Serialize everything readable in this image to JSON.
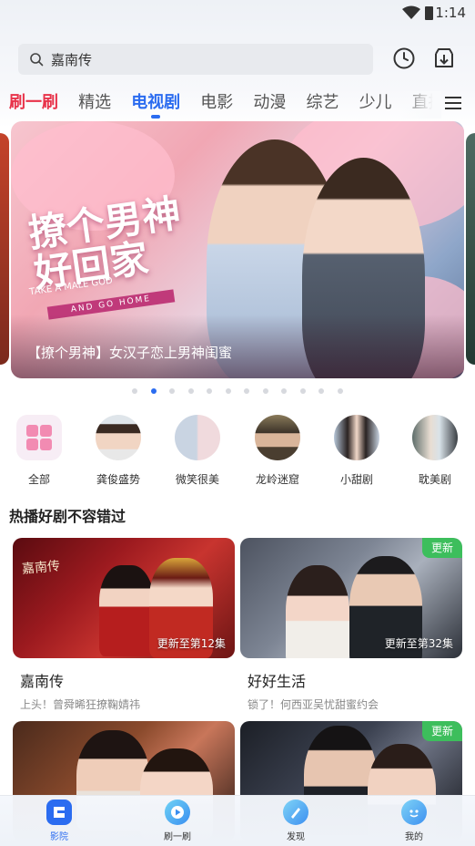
{
  "status_bar": {
    "time": "1:14"
  },
  "search": {
    "query": "嘉南传"
  },
  "tabs": [
    {
      "label": "刷一刷",
      "state": "highlight"
    },
    {
      "label": "精选",
      "state": "normal"
    },
    {
      "label": "电视剧",
      "state": "active"
    },
    {
      "label": "电影",
      "state": "normal"
    },
    {
      "label": "动漫",
      "state": "normal"
    },
    {
      "label": "综艺",
      "state": "normal"
    },
    {
      "label": "少儿",
      "state": "normal"
    },
    {
      "label": "直播",
      "state": "normal"
    }
  ],
  "banner": {
    "caption": "【撩个男神】女汉子恋上男神闺蜜",
    "logo_title": "撩个男神好回家",
    "logo_sub": "TAKE A MALE GOD",
    "logo_band": "AND GO HOME",
    "page_count": 12,
    "active_index": 1
  },
  "categories": [
    {
      "label": "全部",
      "icon": "grid-icon"
    },
    {
      "label": "龚俊盛势",
      "icon": "avatar"
    },
    {
      "label": "微笑很美",
      "icon": "avatar"
    },
    {
      "label": "龙岭迷窟",
      "icon": "avatar"
    },
    {
      "label": "小甜剧",
      "icon": "avatar"
    },
    {
      "label": "耽美剧",
      "icon": "avatar"
    }
  ],
  "section": {
    "title": "热播好剧不容错过"
  },
  "cards": [
    {
      "title": "嘉南传",
      "subtitle": "上头！曾舜晞狂撩鞠婧祎",
      "update": "更新至第12集",
      "badge": "",
      "thumb_text": "嘉南传"
    },
    {
      "title": "好好生活",
      "subtitle": "锁了！何西亚吴忧甜蜜约会",
      "update": "更新至第32集",
      "badge": "更新",
      "thumb_text": ""
    },
    {
      "title": "",
      "subtitle": "",
      "update": "",
      "badge": "",
      "thumb_text": ""
    },
    {
      "title": "",
      "subtitle": "",
      "update": "",
      "badge": "更新",
      "thumb_text": ""
    }
  ],
  "bottom_nav": [
    {
      "label": "影院",
      "active": true
    },
    {
      "label": "刷一刷",
      "active": false
    },
    {
      "label": "发现",
      "active": false
    },
    {
      "label": "我的",
      "active": false
    }
  ],
  "colors": {
    "accent": "#2b6cf0",
    "highlight_tab": "#e8334a",
    "badge": "#3dbe5c"
  }
}
